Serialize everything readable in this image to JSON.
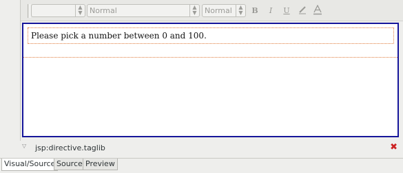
{
  "toolbar": {
    "style_combo": "",
    "paragraph_combo": "Normal",
    "size_combo": "Normal",
    "bold_label": "B",
    "italic_label": "I",
    "underline_label": "U",
    "highlight_icon": "highlighter-icon",
    "font_color_icon": "font-color-icon"
  },
  "editor": {
    "paragraph_text": "Please pick a number between 0 and 100."
  },
  "status": {
    "tag_label": "jsp:directive.taglib"
  },
  "tabs": [
    {
      "label": "Visual/Source"
    },
    {
      "label": "Source"
    },
    {
      "label": "Preview"
    }
  ],
  "colors": {
    "editor_border": "#15159a",
    "element_outline": "#e07a3a",
    "close_icon": "#cc2222"
  }
}
